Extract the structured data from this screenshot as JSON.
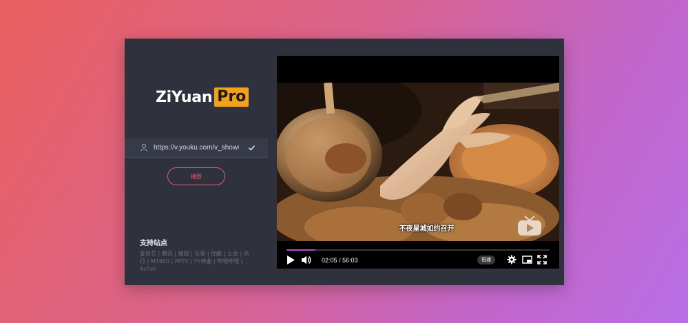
{
  "logo": {
    "main": "ZiYuan",
    "badge": "Pro"
  },
  "url_input": {
    "value": "https://v.youku.com/v_show/id_XNDU"
  },
  "play_button": {
    "label": "播放"
  },
  "supported": {
    "title": "支持站点",
    "sites": "爱奇艺 | 腾讯 | 搜狐 | 乐视 | 优酷 | 土豆 | 风行 | M1950 | PPTV | YY神曲 | 哔哩哔哩 | AcFun"
  },
  "player": {
    "subtitle": "不夜星城如约召开",
    "current_time": "02:05",
    "separator": " / ",
    "duration": "56:03",
    "speed_label": "倍速",
    "progress_fraction": 0.111
  },
  "icons": {
    "user": "user-icon",
    "check": "check-icon",
    "play": "play-icon",
    "volume": "volume-icon",
    "settings": "gear-icon",
    "pip": "picture-in-picture-icon",
    "fullscreen": "fullscreen-icon",
    "watermark": "tv-logo-icon"
  },
  "colors": {
    "accent_pink": "#e25b78",
    "logo_badge": "#f5a01a",
    "progress": "#b34fd9",
    "panel": "#2f313d"
  }
}
